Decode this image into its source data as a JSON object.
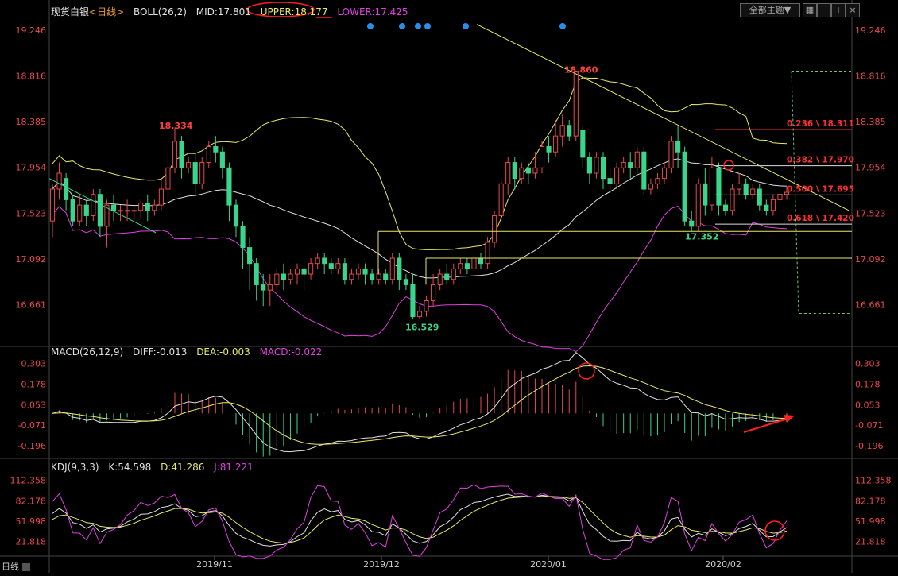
{
  "header": {
    "title": "现货白银",
    "period_tag": "<日线>",
    "boll_label": "BOLL(26,2)",
    "mid": "MID:17.801",
    "upper": "UPPER:18.177",
    "lower": "LOWER:17.425",
    "theme_button": "全部主题▼",
    "icons": [
      "grid-icon",
      "minus-icon",
      "plus-icon",
      "close-icon"
    ]
  },
  "macd_header": {
    "label": "MACD(26,12,9)",
    "diff": "DIFF:-0.013",
    "dea": "DEA:-0.003",
    "macd": "MACD:-0.022"
  },
  "kdj_header": {
    "label": "KDJ(9,3,3)",
    "k": "K:54.598",
    "d": "D:41.286",
    "j": "J:81.221"
  },
  "period_selector": "日线",
  "colors": {
    "up": "#e84a4a",
    "down": "#3ad48a",
    "boll_upper_lower": "#e040e0",
    "boll_mid": "#e0e0e0",
    "boll_band_upper": "#e8e86a",
    "trend": "#e8e86a",
    "annotation_red": "#ff2020",
    "fib": "#ff3030",
    "marker_blue": "#2a8ee8"
  },
  "chart_data": [
    {
      "type": "candlestick",
      "name": "price",
      "yticks": [
        "19.246",
        "18.816",
        "18.385",
        "17.954",
        "17.523",
        "17.092",
        "16.661"
      ],
      "ylim": [
        16.3,
        19.35
      ],
      "x_labels": [
        "2019/11",
        "2019/12",
        "2020/01",
        "2020/02"
      ],
      "annotations": [
        "18.334",
        "18.860",
        "16.529",
        "17.352"
      ],
      "fibonacci": [
        {
          "label": "0.236 \\ 18.311",
          "value": 18.311
        },
        {
          "label": "0.382 \\ 17.970",
          "value": 17.97
        },
        {
          "label": "0.500 \\ 17.695",
          "value": 17.695
        },
        {
          "label": "0.618 \\ 17.420",
          "value": 17.42
        }
      ],
      "candles": [
        [
          17.45,
          17.75,
          17.3,
          17.8
        ],
        [
          17.75,
          17.9,
          17.65,
          18.0
        ],
        [
          17.85,
          17.65,
          17.55,
          17.9
        ],
        [
          17.65,
          17.45,
          17.4,
          17.7
        ],
        [
          17.45,
          17.6,
          17.4,
          17.7
        ],
        [
          17.6,
          17.5,
          17.4,
          17.65
        ],
        [
          17.5,
          17.7,
          17.45,
          17.75
        ],
        [
          17.7,
          17.4,
          17.3,
          17.75
        ],
        [
          17.4,
          17.6,
          17.2,
          17.65
        ],
        [
          17.6,
          17.55,
          17.45,
          17.7
        ],
        [
          17.55,
          17.55,
          17.45,
          17.6
        ],
        [
          17.55,
          17.55,
          17.45,
          17.65
        ],
        [
          17.55,
          17.55,
          17.45,
          17.6
        ],
        [
          17.55,
          17.62,
          17.48,
          17.65
        ],
        [
          17.62,
          17.55,
          17.45,
          17.7
        ],
        [
          17.55,
          17.6,
          17.5,
          17.65
        ],
        [
          17.6,
          17.75,
          17.55,
          17.85
        ],
        [
          17.75,
          17.95,
          17.65,
          18.1
        ],
        [
          17.95,
          18.2,
          17.9,
          18.33
        ],
        [
          18.2,
          17.95,
          17.85,
          18.25
        ],
        [
          17.95,
          18.0,
          17.9,
          18.05
        ],
        [
          18.0,
          17.8,
          17.7,
          18.1
        ],
        [
          17.8,
          18.0,
          17.75,
          18.05
        ],
        [
          18.0,
          18.15,
          17.95,
          18.2
        ],
        [
          18.15,
          18.1,
          18.0,
          18.25
        ],
        [
          18.1,
          17.95,
          17.85,
          18.15
        ],
        [
          17.95,
          17.6,
          17.45,
          18.0
        ],
        [
          17.6,
          17.4,
          17.3,
          17.65
        ],
        [
          17.4,
          17.2,
          17.0,
          17.45
        ],
        [
          17.2,
          17.05,
          16.8,
          17.3
        ],
        [
          17.05,
          16.85,
          16.7,
          17.1
        ],
        [
          16.85,
          16.8,
          16.65,
          16.95
        ],
        [
          16.8,
          16.85,
          16.65,
          16.95
        ],
        [
          16.85,
          16.95,
          16.8,
          17.0
        ],
        [
          16.95,
          16.9,
          16.8,
          17.05
        ],
        [
          16.9,
          16.95,
          16.85,
          17.0
        ],
        [
          16.95,
          17.0,
          16.85,
          17.05
        ],
        [
          17.0,
          16.95,
          16.8,
          17.05
        ],
        [
          16.95,
          17.05,
          16.9,
          17.1
        ],
        [
          17.05,
          17.1,
          17.0,
          17.15
        ],
        [
          17.1,
          17.05,
          16.95,
          17.15
        ],
        [
          17.05,
          17.0,
          16.95,
          17.1
        ],
        [
          17.0,
          17.05,
          16.95,
          17.1
        ],
        [
          17.05,
          16.9,
          16.85,
          17.1
        ],
        [
          16.9,
          16.95,
          16.85,
          17.0
        ],
        [
          16.95,
          17.0,
          16.9,
          17.05
        ],
        [
          17.0,
          16.95,
          16.85,
          17.05
        ],
        [
          16.95,
          16.9,
          16.85,
          17.0
        ],
        [
          16.9,
          16.95,
          16.85,
          17.0
        ],
        [
          16.95,
          16.9,
          16.85,
          17.0
        ],
        [
          16.9,
          17.1,
          16.85,
          17.15
        ],
        [
          17.1,
          16.9,
          16.8,
          17.15
        ],
        [
          16.9,
          16.85,
          16.8,
          16.95
        ],
        [
          16.85,
          16.55,
          16.53,
          16.95
        ],
        [
          16.55,
          16.6,
          16.53,
          16.65
        ],
        [
          16.6,
          16.7,
          16.55,
          16.75
        ],
        [
          16.7,
          16.85,
          16.65,
          16.95
        ],
        [
          16.85,
          16.95,
          16.8,
          17.0
        ],
        [
          16.95,
          16.9,
          16.85,
          17.05
        ],
        [
          16.9,
          17.0,
          16.85,
          17.05
        ],
        [
          17.0,
          17.05,
          16.95,
          17.1
        ],
        [
          17.05,
          17.0,
          16.95,
          17.1
        ],
        [
          17.0,
          17.1,
          16.95,
          17.15
        ],
        [
          17.1,
          17.05,
          17.0,
          17.15
        ],
        [
          17.05,
          17.25,
          17.0,
          17.3
        ],
        [
          17.25,
          17.5,
          17.2,
          17.55
        ],
        [
          17.5,
          17.8,
          17.45,
          17.85
        ],
        [
          17.8,
          18.0,
          17.7,
          18.05
        ],
        [
          18.0,
          17.85,
          17.75,
          18.05
        ],
        [
          17.85,
          17.95,
          17.8,
          18.0
        ],
        [
          17.95,
          17.9,
          17.8,
          18.0
        ],
        [
          17.9,
          17.95,
          17.85,
          18.1
        ],
        [
          17.95,
          18.15,
          17.9,
          18.2
        ],
        [
          18.15,
          18.1,
          18.0,
          18.25
        ],
        [
          18.1,
          18.25,
          18.05,
          18.4
        ],
        [
          18.25,
          18.35,
          18.15,
          18.45
        ],
        [
          18.35,
          18.25,
          18.2,
          18.4
        ],
        [
          18.25,
          18.86,
          18.2,
          18.86
        ],
        [
          18.3,
          18.05,
          17.95,
          18.35
        ],
        [
          18.05,
          17.9,
          17.8,
          18.1
        ],
        [
          17.9,
          18.05,
          17.85,
          18.1
        ],
        [
          18.05,
          17.85,
          17.75,
          18.1
        ],
        [
          17.85,
          17.8,
          17.7,
          17.95
        ],
        [
          17.8,
          17.95,
          17.75,
          18.0
        ],
        [
          17.95,
          18.0,
          17.9,
          18.05
        ],
        [
          18.0,
          17.95,
          17.85,
          18.1
        ],
        [
          17.95,
          18.1,
          17.9,
          18.15
        ],
        [
          18.1,
          17.75,
          17.7,
          18.15
        ],
        [
          17.75,
          17.8,
          17.7,
          17.85
        ],
        [
          17.8,
          17.85,
          17.75,
          17.9
        ],
        [
          17.85,
          17.95,
          17.8,
          18.0
        ],
        [
          17.95,
          18.2,
          17.9,
          18.25
        ],
        [
          18.2,
          18.1,
          17.95,
          18.35
        ],
        [
          18.1,
          17.45,
          17.4,
          18.15
        ],
        [
          17.45,
          17.4,
          17.35,
          17.55
        ],
        [
          17.4,
          17.8,
          17.35,
          17.85
        ],
        [
          17.8,
          17.6,
          17.5,
          17.95
        ],
        [
          17.6,
          17.95,
          17.55,
          18.05
        ],
        [
          17.95,
          17.6,
          17.5,
          18.0
        ],
        [
          17.6,
          17.55,
          17.5,
          17.65
        ],
        [
          17.55,
          17.75,
          17.5,
          17.8
        ],
        [
          17.75,
          17.8,
          17.7,
          17.9
        ],
        [
          17.8,
          17.7,
          17.65,
          17.85
        ],
        [
          17.7,
          17.75,
          17.65,
          17.8
        ],
        [
          17.75,
          17.6,
          17.55,
          17.8
        ],
        [
          17.6,
          17.55,
          17.5,
          17.65
        ],
        [
          17.55,
          17.65,
          17.5,
          17.7
        ],
        [
          17.65,
          17.7,
          17.6,
          17.75
        ],
        [
          17.7,
          17.72,
          17.65,
          17.78
        ]
      ]
    },
    {
      "type": "macd",
      "yticks": [
        "0.303",
        "0.178",
        "0.053",
        "-0.071",
        "-0.196"
      ],
      "ylim": [
        -0.25,
        0.33
      ]
    },
    {
      "type": "kdj",
      "yticks": [
        "112.358",
        "82.178",
        "51.998",
        "21.818"
      ],
      "ylim": [
        0,
        125
      ]
    }
  ]
}
